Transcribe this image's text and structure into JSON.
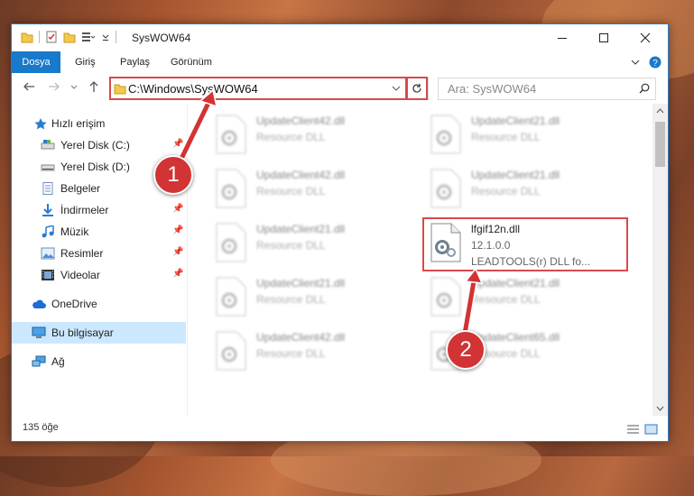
{
  "window": {
    "title": "SysWOW64"
  },
  "ribbon": {
    "tabs": [
      "Dosya",
      "Giriş",
      "Paylaş",
      "Görünüm"
    ]
  },
  "address": {
    "path": "C:\\Windows\\SysWOW64"
  },
  "search": {
    "placeholder": "Ara: SysWOW64"
  },
  "sidebar": {
    "items": [
      {
        "label": "Hızlı erişim",
        "icon": "star-icon"
      },
      {
        "label": "Yerel Disk (C:)",
        "icon": "drive-icon",
        "pinned": true
      },
      {
        "label": "Yerel Disk (D:)",
        "icon": "drive-icon",
        "pinned": true
      },
      {
        "label": "Belgeler",
        "icon": "documents-icon",
        "pinned": true
      },
      {
        "label": "İndirmeler",
        "icon": "download-icon",
        "pinned": true
      },
      {
        "label": "Müzik",
        "icon": "music-icon",
        "pinned": true
      },
      {
        "label": "Resimler",
        "icon": "pictures-icon",
        "pinned": true
      },
      {
        "label": "Videolar",
        "icon": "videos-icon",
        "pinned": true
      },
      {
        "label": "OneDrive",
        "icon": "cloud-icon"
      },
      {
        "label": "Bu bilgisayar",
        "icon": "computer-icon"
      },
      {
        "label": "Ağ",
        "icon": "network-icon"
      }
    ]
  },
  "files": {
    "left": [
      {
        "name": "UpdateClient42.dll",
        "desc": "Resource DLL"
      },
      {
        "name": "UpdateClient42.dll",
        "desc": "Resource DLL"
      },
      {
        "name": "UpdateClient21.dll",
        "desc": "Resource DLL"
      },
      {
        "name": "UpdateClient21.dll",
        "desc": "Resource DLL"
      },
      {
        "name": "UpdateClient42.dll",
        "desc": "Resource DLL"
      }
    ],
    "right": [
      {
        "name": "UpdateClient21.dll",
        "desc": "Resource DLL"
      },
      {
        "name": "UpdateClient21.dll",
        "desc": "Resource DLL"
      },
      {
        "name": "UpdateClient21.dll",
        "desc": "Resource DLL"
      },
      {
        "name": "UpdateClient65.dll",
        "desc": "Resource DLL"
      }
    ],
    "selected": {
      "name": "lfgif12n.dll",
      "version": "12.1.0.0",
      "desc": "LEADTOOLS(r) DLL fo..."
    }
  },
  "status": {
    "count": "135 öğe"
  },
  "callouts": [
    "1",
    "2"
  ],
  "colors": {
    "accent": "#1979ca",
    "highlight": "#d9494a",
    "callout": "#d23334"
  }
}
